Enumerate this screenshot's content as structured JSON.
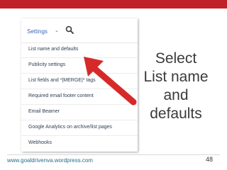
{
  "colors": {
    "top_bar": "#c0202a",
    "link": "#3b67b8",
    "arrow": "#d62a2a",
    "caption": "#3a3a3a",
    "footer": "#2c6a8c"
  },
  "menu": {
    "title": "Settings",
    "chevron": "⌄",
    "search_icon": "search-icon",
    "items": [
      {
        "label": "List name and defaults"
      },
      {
        "label": "Publicity settings"
      },
      {
        "label": "List fields and *|MERGE|* tags"
      },
      {
        "label": "Required email footer content"
      },
      {
        "label": "Email Beamer"
      },
      {
        "label": "Google Analytics on archive/list pages"
      },
      {
        "label": "Webhooks"
      }
    ]
  },
  "caption": {
    "lines": [
      "Select",
      "List name",
      "and",
      "defaults"
    ]
  },
  "footer": {
    "url": "www.goaldrivenva.wordpress.com",
    "page_number": "48"
  }
}
